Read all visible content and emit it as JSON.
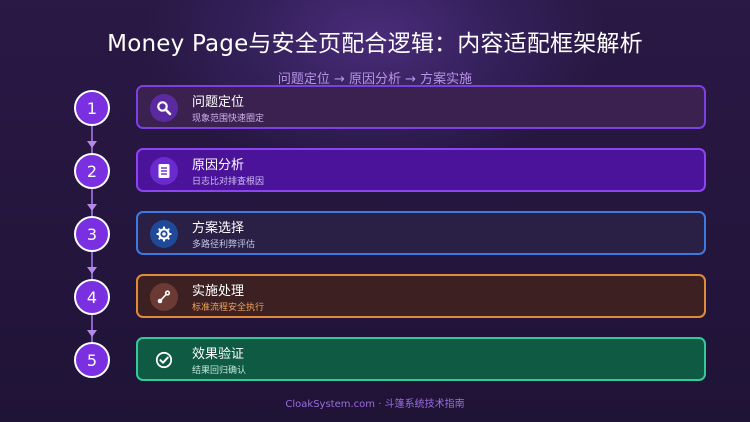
{
  "title": "Money Page与安全页配合逻辑：内容适配框架解析",
  "subtitle": "问题定位 → 原因分析 → 方案实施",
  "steps": [
    {
      "number": "1",
      "title": "问题定位",
      "desc": "现象范围快速圈定",
      "icon": "search-icon",
      "card_bg": "#3a2150",
      "border": "#7b3fe4",
      "icon_bg": "#5b2aa0",
      "desc_color": "#c9b3ec"
    },
    {
      "number": "2",
      "title": "原因分析",
      "desc": "日志比对排查根因",
      "icon": "document-icon",
      "card_bg": "#4a139a",
      "border": "#8a44f0",
      "icon_bg": "#6a2ad0",
      "desc_color": "#d2bdf2"
    },
    {
      "number": "3",
      "title": "方案选择",
      "desc": "多路径利弊评估",
      "icon": "gear-icon",
      "card_bg": "#2a1f45",
      "border": "#3d7ae0",
      "icon_bg": "#1f4a9a",
      "desc_color": "#c2c8e6"
    },
    {
      "number": "4",
      "title": "实施处理",
      "desc": "标准流程安全执行",
      "icon": "route-icon",
      "card_bg": "#3d2122",
      "border": "#e08a3a",
      "icon_bg": "#6b3a35",
      "desc_color": "#f0a35a"
    },
    {
      "number": "5",
      "title": "效果验证",
      "desc": "结果回归确认",
      "icon": "check-circle-icon",
      "card_bg": "#0f5a42",
      "border": "#35c99a",
      "icon_bg": "#0f5a42",
      "desc_color": "#bfe8d8"
    }
  ],
  "footer": "CloakSystem.com · 斗篷系统技术指南"
}
